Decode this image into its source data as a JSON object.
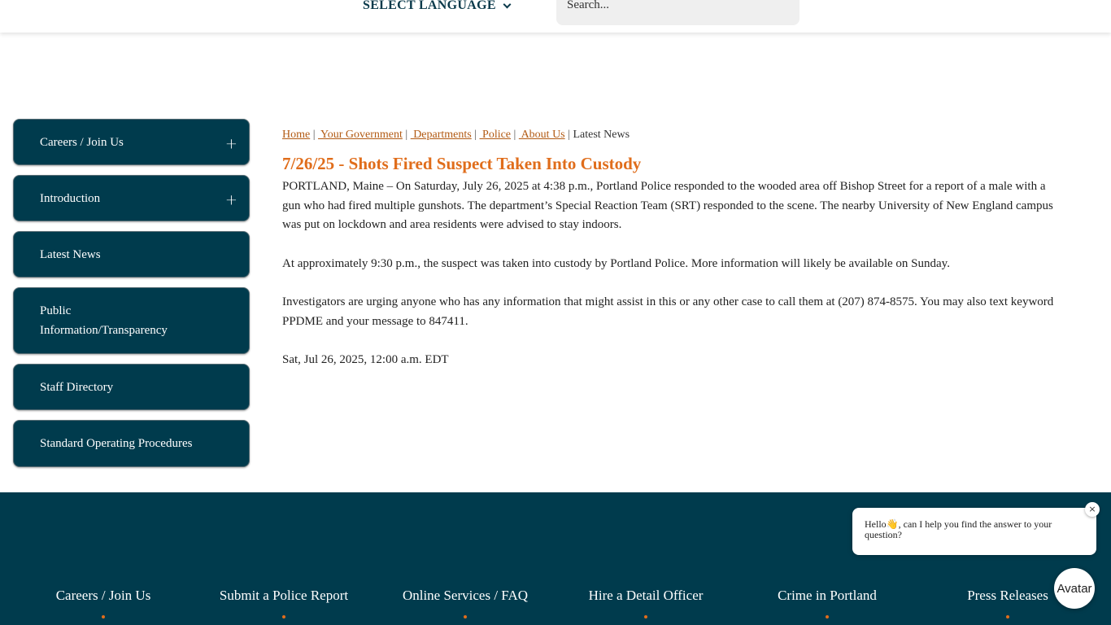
{
  "header": {
    "language_label": "SELECT LANGUAGE",
    "search_placeholder": "Search..."
  },
  "sidebar": {
    "items": [
      {
        "label": "Careers / Join Us",
        "expandable": "+"
      },
      {
        "label": "Introduction",
        "expandable": "+"
      },
      {
        "label": "Latest News"
      },
      {
        "label": "Public Information/Transparency"
      },
      {
        "label": "Staff Directory"
      },
      {
        "label": "Standard Operating Procedures"
      }
    ]
  },
  "breadcrumb": {
    "items": [
      "Home",
      " Your Government",
      " Departments",
      " Police",
      " About Us"
    ],
    "separator": " | ",
    "current": "Latest News"
  },
  "article": {
    "title": "7/26/25 - Shots Fired Suspect Taken Into Custody",
    "paragraphs": [
      "PORTLAND, Maine – On Saturday, July 26, 2025 at 4:38 p.m., Portland Police responded to the wooded area off Bishop Street for a report of a male with a gun who had fired multiple gunshots. The department’s Special Reaction Team (SRT) responded to the scene. The nearby University of New England campus was put on lockdown and area residents were advised to stay indoors.",
      "At approximately 9:30 p.m., the suspect was taken into custody by Portland Police. More information will likely be available on Sunday.",
      "Investigators are urging anyone who has any information that might assist in this or any other case to call them at (207) 874-8575. You may also text keyword PPDME and your message to 847411."
    ],
    "date": "Sat, Jul 26, 2025, 12:00 a.m. EDT"
  },
  "footer": {
    "links": [
      "Careers / Join Us",
      "Submit a Police Report",
      "Online Services / FAQ",
      "Hire a Detail Officer",
      "Crime in Portland",
      "Press Releases"
    ]
  },
  "chat": {
    "greeting_prefix": "Hello",
    "greeting_emoji": "👋",
    "greeting_rest": ", can I help you find the answer to your question?",
    "close_symbol": "×",
    "avatar_label": "Avatar"
  },
  "colors": {
    "navy": "#003b4d",
    "accent_orange": "#e06d1b",
    "link_brown": "#b25a13"
  }
}
